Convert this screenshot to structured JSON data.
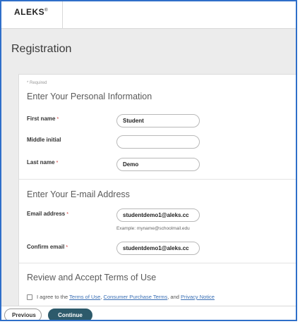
{
  "header": {
    "logo": "ALEKS",
    "logo_mark": "®"
  },
  "page": {
    "title": "Registration"
  },
  "form": {
    "required_note": "* Required",
    "personal": {
      "title": "Enter Your Personal Information",
      "first_name": {
        "label": "First name",
        "value": "Student",
        "required": "*"
      },
      "middle_initial": {
        "label": "Middle initial",
        "value": ""
      },
      "last_name": {
        "label": "Last name",
        "value": "Demo",
        "required": "*"
      }
    },
    "email": {
      "title": "Enter Your E-mail Address",
      "email_address": {
        "label": "Email address",
        "value": "studentdemo1@aleks.cc",
        "required": "*"
      },
      "hint": "Example: myname@schoolmail.edu",
      "confirm_email": {
        "label": "Confirm email",
        "value": "studentdemo1@aleks.cc",
        "required": "*"
      }
    },
    "terms": {
      "title": "Review and Accept Terms of Use",
      "agree_prefix": "I agree to the",
      "terms_of_use": "Terms of Use",
      "sep1": ",",
      "consumer_terms": "Consumer Purchase Terms",
      "sep2": ", and",
      "privacy_notice": "Privacy Notice",
      "checked": false
    }
  },
  "footer": {
    "previous": "Previous",
    "continue": "Continue"
  },
  "colors": {
    "accent": "#2d5a6b",
    "link": "#3a6fb5",
    "frame": "#2f6fc9"
  }
}
